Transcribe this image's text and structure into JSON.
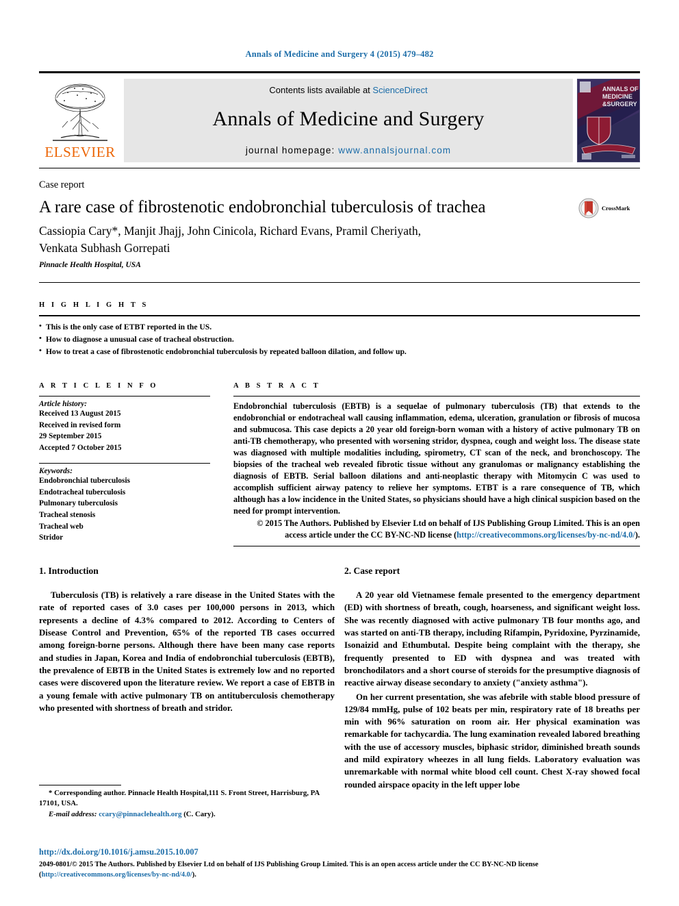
{
  "running_head": "Annals of Medicine and Surgery 4 (2015) 479–482",
  "masthead": {
    "publisher": "ELSEVIER",
    "contents_prefix": "Contents lists available at ",
    "contents_link": "ScienceDirect",
    "journal_title": "Annals of Medicine and Surgery",
    "homepage_prefix": "journal homepage: ",
    "homepage_url": "www.annalsjournal.com",
    "cover": {
      "line1": "ANNALS OF",
      "line2": "MEDICINE",
      "line3": "&SURGERY"
    }
  },
  "article": {
    "doctype": "Case report",
    "title": "A rare case of fibrostenotic endobronchial tuberculosis of trachea",
    "authors_line1": "Cassiopia Cary*, Manjit Jhajj, John Cinicola, Richard Evans, Pramil Cheriyath,",
    "authors_line2": "Venkata Subhash Gorrepati",
    "affiliation": "Pinnacle Health Hospital, USA",
    "crossmark_label": "CrossMark"
  },
  "highlights": {
    "heading": "H I G H L I G H T S",
    "items": [
      "This is the only case of ETBT reported in the US.",
      "How to diagnose a unusual case of tracheal obstruction.",
      "How to treat a case of fibrostenotic endobronchial tuberculosis by repeated balloon dilation, and follow up."
    ]
  },
  "article_info": {
    "heading": "A R T I C L E    I N F O",
    "history_label": "Article history:",
    "history": [
      "Received 13 August 2015",
      "Received in revised form",
      "29 September 2015",
      "Accepted 7 October 2015"
    ],
    "keywords_label": "Keywords:",
    "keywords": [
      "Endobronchial tuberculosis",
      "Endotracheal tuberculosis",
      "Pulmonary tuberculosis",
      "Tracheal stenosis",
      "Tracheal web",
      "Stridor"
    ]
  },
  "abstract": {
    "heading": "A B S T R A C T",
    "body": "Endobronchial tuberculosis (EBTB) is a sequelae of pulmonary tuberculosis (TB) that extends to the endobronchial or endotracheal wall causing inflammation, edema, ulceration, granulation or fibrosis of mucosa and submucosa. This case depicts a 20 year old foreign-born woman with a history of active pulmonary TB on anti-TB chemotherapy, who presented with worsening stridor, dyspnea, cough and weight loss. The disease state was diagnosed with multiple modalities including, spirometry, CT scan of the neck, and bronchoscopy. The biopsies of the tracheal web revealed fibrotic tissue without any granulomas or malignancy establishing the diagnosis of EBTB. Serial balloon dilations and anti-neoplastic therapy with Mitomycin C was used to accomplish sufficient airway patency to relieve her symptoms. ETBT is a rare consequence of TB, which although has a low incidence in the United States, so physicians should have a high clinical suspicion based on the need for prompt intervention.",
    "copyright_text": "© 2015 The Authors. Published by Elsevier Ltd on behalf of IJS Publishing Group Limited. This is an open access article under the CC BY-NC-ND license (",
    "copyright_link": "http://creativecommons.org/licenses/by-nc-nd/4.0/",
    "copyright_tail": ")."
  },
  "sections": {
    "introduction": {
      "heading": "1. Introduction",
      "paragraphs": [
        "Tuberculosis (TB) is relatively a rare disease in the United States with the rate of reported cases of 3.0 cases per 100,000 persons in 2013, which represents a decline of 4.3% compared to 2012. According to Centers of Disease Control and Prevention, 65% of the reported TB cases occurred among foreign-borne persons. Although there have been many case reports and studies in Japan, Korea and India of endobronchial tuberculosis (EBTB), the prevalence of EBTB in the United States is extremely low and no reported cases were discovered upon the literature review. We report a case of EBTB in a young female with active pulmonary TB on antituberculosis chemotherapy who presented with shortness of breath and stridor."
      ]
    },
    "case_report": {
      "heading": "2. Case report",
      "paragraphs": [
        "A 20 year old Vietnamese female presented to the emergency department (ED) with shortness of breath, cough, hoarseness, and significant weight loss. She was recently diagnosed with active pulmonary TB four months ago, and was started on anti-TB therapy, including Rifampin, Pyridoxine, Pyrzinamide, Isonaizid and Ethumbutal. Despite being complaint with the therapy, she frequently presented to ED with dyspnea and was treated with bronchodilators and a short course of steroids for the presumptive diagnosis of reactive airway disease secondary to anxiety (\"anxiety asthma\").",
        "On her current presentation, she was afebrile with stable blood pressure of 129/84 mmHg, pulse of 102 beats per min, respiratory rate of 18 breaths per min with 96% saturation on room air. Her physical examination was remarkable for tachycardia. The lung examination revealed labored breathing with the use of accessory muscles, biphasic stridor, diminished breath sounds and mild expiratory wheezes in all lung fields. Laboratory evaluation was unremarkable with normal white blood cell count. Chest X-ray showed focal rounded airspace opacity in the left upper lobe"
      ]
    }
  },
  "footnote": {
    "corresponding": "* Corresponding author. Pinnacle Health Hospital,111 S. Front Street, Harrisburg, PA 17101, USA.",
    "email_label": "E-mail address:",
    "email": "ccary@pinnaclehealth.org",
    "email_suffix": "(C. Cary)."
  },
  "footer": {
    "doi": "http://dx.doi.org/10.1016/j.amsu.2015.10.007",
    "issn_line": "2049-0801/© 2015 The Authors. Published by Elsevier Ltd on behalf of IJS Publishing Group Limited. This is an open access article under the CC BY-NC-ND license (",
    "license_link": "http://creativecommons.org/licenses/by-nc-nd/4.0/",
    "license_tail": ")."
  },
  "colors": {
    "link": "#1b6ca8",
    "elsevier_orange": "#ec6607",
    "band_gray": "#e6e6e6"
  }
}
